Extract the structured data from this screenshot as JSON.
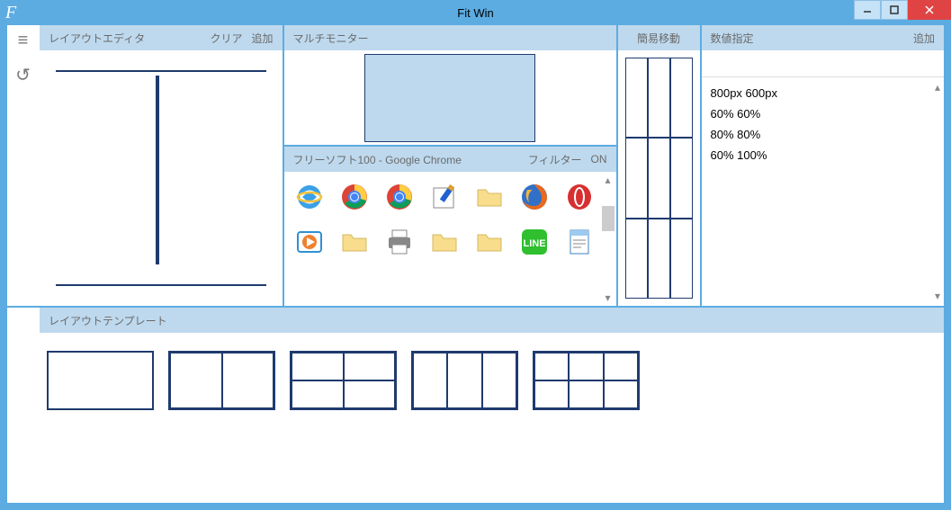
{
  "app": {
    "title": "Fit Win",
    "icon_letter": "F"
  },
  "window_controls": {
    "min": "—",
    "max": "□",
    "close": "✕"
  },
  "left_tools": [
    {
      "name": "menu-icon",
      "glyph": "≡"
    },
    {
      "name": "undo-icon",
      "glyph": "↺"
    }
  ],
  "layout_editor": {
    "title": "レイアウトエディタ",
    "clear": "クリア",
    "add": "追加"
  },
  "multi_monitor": {
    "title": "マルチモニター"
  },
  "quick_move": {
    "title": "簡易移動"
  },
  "window_picker": {
    "title": "フリーソフト100 - Google Chrome",
    "filter_label": "フィルター",
    "on_label": "ON",
    "icons": [
      "ie",
      "chrome",
      "chrome",
      "notepad",
      "folder",
      "firefox",
      "opera",
      "mediaplayer",
      "folder",
      "printer",
      "folder",
      "folder",
      "line",
      "wordpad"
    ]
  },
  "numeric": {
    "title": "数値指定",
    "add": "追加",
    "items": [
      "800px 600px",
      "60% 60%",
      "80% 80%",
      "60% 100%"
    ]
  },
  "templates": {
    "title": "レイアウトテンプレート",
    "list": [
      {
        "cols": 1,
        "rows": 1
      },
      {
        "cols": 2,
        "rows": 1
      },
      {
        "cols": 2,
        "rows": 2
      },
      {
        "cols": 3,
        "rows": 1
      },
      {
        "cols": 3,
        "rows": 2
      }
    ]
  }
}
